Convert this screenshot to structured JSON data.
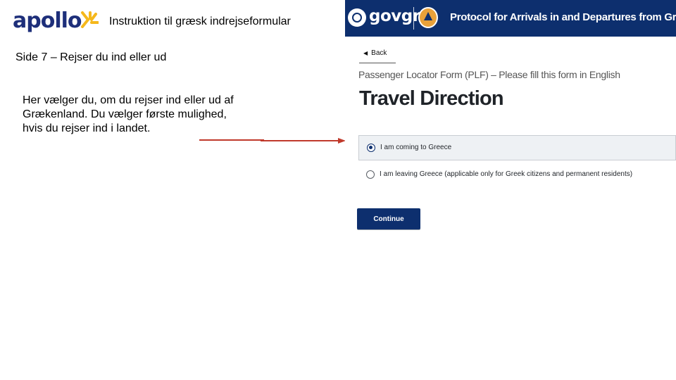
{
  "slide": {
    "logo_text": "apollo",
    "title": "Instruktion til græsk indrejseformular",
    "step_title": "Side 7 – Rejser du ind eller ud",
    "description": "Her vælger du, om du rejser ind eller ud af Grækenland. Du vælger første mulighed, hvis du rejser ind i landet."
  },
  "screenshot": {
    "header": {
      "brand": "govgr",
      "title": "Protocol for Arrivals in and Departures from Greece"
    },
    "back_label": "Back",
    "subtitle": "Passenger Locator Form (PLF) – Please fill this form in English",
    "page_title": "Travel Direction",
    "options": [
      {
        "label": "I am coming to Greece",
        "selected": true
      },
      {
        "label": "I am leaving Greece (applicable only for Greek citizens and permanent residents)",
        "selected": false
      }
    ],
    "continue_label": "Continue"
  },
  "colors": {
    "brand_navy": "#0d2f6e",
    "apollo_blue": "#1e2f7a",
    "apollo_yellow": "#f5b81c",
    "annotation_red": "#c0392b"
  },
  "icons": {
    "logo_mark": "apollo-sun-icon",
    "back": "caret-left-icon",
    "gov_emblem": "greek-emblem-icon",
    "civil_protection": "civil-protection-icon"
  }
}
